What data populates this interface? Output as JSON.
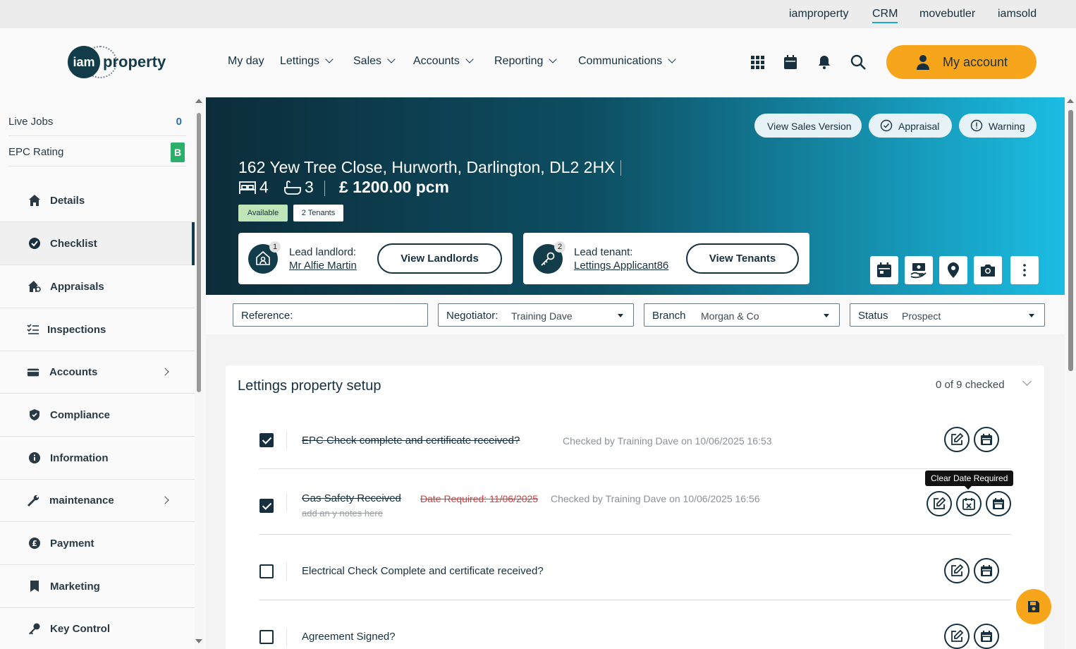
{
  "topbar": {
    "links": [
      "iamproperty",
      "CRM",
      "movebutler",
      "iamsold"
    ],
    "active": "CRM"
  },
  "header": {
    "logo": {
      "mark": "iam",
      "word": "property"
    },
    "nav": [
      "My day",
      "Lettings",
      "Sales",
      "Accounts",
      "Reporting",
      "Communications"
    ],
    "icons": [
      "apps-grid-icon",
      "calendar-icon",
      "bell-icon",
      "search-icon"
    ],
    "account_label": "My account"
  },
  "sidebar": {
    "stats": [
      {
        "label": "Live Jobs",
        "value": "0"
      },
      {
        "label": "EPC Rating",
        "value": "B"
      }
    ],
    "items": [
      {
        "label": "Details",
        "icon": "home-icon"
      },
      {
        "label": "Checklist",
        "icon": "check-circle-icon",
        "active": true
      },
      {
        "label": "Appraisals",
        "icon": "house-search-icon"
      },
      {
        "label": "Inspections",
        "icon": "list-check-icon"
      },
      {
        "label": "Accounts",
        "icon": "credit-card-icon",
        "submenu": true
      },
      {
        "label": "Compliance",
        "icon": "shield-icon"
      },
      {
        "label": "Information",
        "icon": "info-icon"
      },
      {
        "label": "maintenance",
        "icon": "wrench-icon",
        "submenu": true
      },
      {
        "label": "Payment",
        "icon": "pound-icon"
      },
      {
        "label": "Marketing",
        "icon": "bookmark-icon"
      },
      {
        "label": "Key Control",
        "icon": "key-icon"
      }
    ]
  },
  "property": {
    "actions": [
      "View Sales Version",
      "Appraisal",
      "Warning"
    ],
    "address": "162 Yew Tree Close, Hurworth, Darlington, DL2 2HX",
    "bedrooms": "4",
    "bathrooms": "3",
    "price": "£ 1200.00 pcm",
    "tags": [
      "Available",
      "2 Tenants"
    ],
    "landlord": {
      "count": "1",
      "label": "Lead landlord:",
      "name": "Mr Alfie Martin",
      "button": "View Landlords"
    },
    "tenant": {
      "count": "2",
      "label": "Lead tenant:",
      "name": "Lettings Applicant86",
      "button": "View Tenants"
    },
    "quick_actions": [
      "calendar-icon",
      "money-hand-icon",
      "map-pin-icon",
      "camera-icon",
      "more-vertical-icon"
    ]
  },
  "filters": {
    "reference": {
      "label": "Reference:",
      "value": ""
    },
    "negotiator": {
      "label": "Negotiator:",
      "value": "Training Dave"
    },
    "branch": {
      "label": "Branch",
      "value": "Morgan & Co"
    },
    "status": {
      "label": "Status",
      "value": "Prospect"
    }
  },
  "checklist": {
    "title": "Lettings property setup",
    "summary": "0 of 9 checked",
    "items": [
      {
        "label": "EPC Check complete and certificate received?",
        "checked": true,
        "meta": "Checked by Training Dave on 10/06/2025 16:53"
      },
      {
        "label": "Gas Safety Received",
        "checked": true,
        "date_required": "Date Required: 11/06/2025",
        "meta": "Checked by Training Dave on 10/06/2025 16:56",
        "notes": "add an y notes here"
      },
      {
        "label": "Electrical Check Complete and certificate received?",
        "checked": false
      },
      {
        "label": "Agreement Signed?",
        "checked": false
      }
    ],
    "tooltip": "Clear Date Required"
  },
  "colors": {
    "accent": "#f7a61b",
    "dark": "#123c4a",
    "hero_end": "#1bbde3",
    "epc": "#2bb06b"
  }
}
